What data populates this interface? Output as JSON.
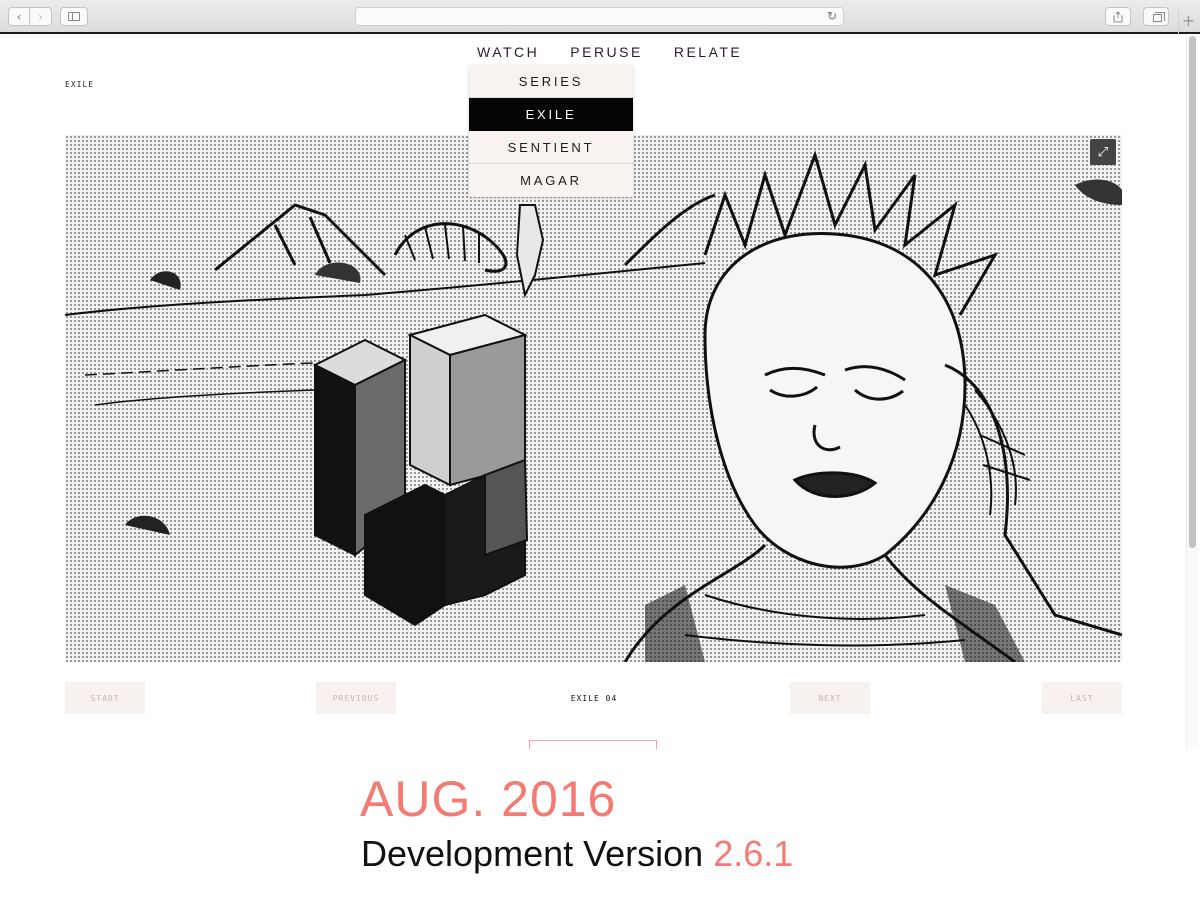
{
  "browser": {
    "address": "",
    "back_icon": "‹",
    "forward_icon": "›",
    "reload_icon": "↻",
    "new_tab_icon": "+"
  },
  "site": {
    "nav": [
      "WATCH",
      "PERUSE",
      "RELATE"
    ],
    "breadcrumb": "EXILE",
    "dropdown": {
      "items": [
        "SERIES",
        "EXILE",
        "SENTIENT",
        "MAGAR"
      ],
      "active": "EXILE"
    },
    "fullscreen_icon": "⤢",
    "pager": {
      "start": "START",
      "previous": "PREVIOUS",
      "current": "EXILE 04",
      "next": "NEXT",
      "last": "LAST"
    }
  },
  "caption": {
    "date": "AUG. 2016",
    "version_label": "Development Version",
    "version_number": "2.6.1"
  },
  "colors": {
    "accent": "#f47b73",
    "nav_text": "#2a1b2e",
    "pager_bg": "#f7f1ef"
  }
}
